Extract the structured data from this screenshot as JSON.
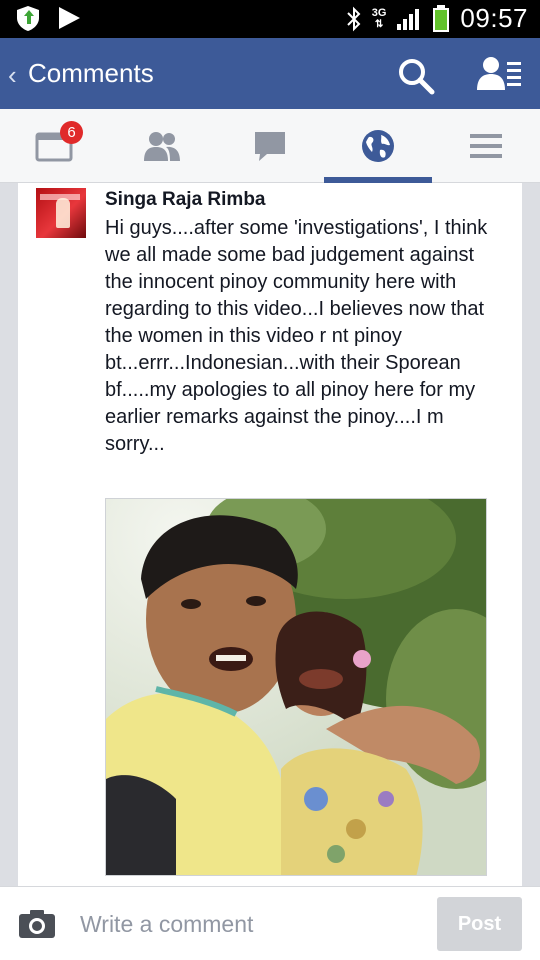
{
  "status_bar": {
    "network_label": "3G",
    "time": "09:57",
    "icons": [
      "shield-icon",
      "play-icon",
      "bluetooth-icon",
      "signal-icon",
      "battery-icon"
    ]
  },
  "app_bar": {
    "back_glyph": "‹",
    "title": "Comments",
    "icons": [
      "search-icon",
      "friends-icon"
    ],
    "background": "#3d5a98"
  },
  "tabs": [
    {
      "id": "news-feed",
      "icon": "news-feed-icon",
      "badge": "6"
    },
    {
      "id": "friend-requests",
      "icon": "friends-icon"
    },
    {
      "id": "messages",
      "icon": "chat-icon"
    },
    {
      "id": "notifications",
      "icon": "globe-icon",
      "active": true
    },
    {
      "id": "more",
      "icon": "menu-icon"
    }
  ],
  "comment": {
    "author": "Singa Raja Rimba",
    "text": "Hi guys....after some 'investigations', I think we all made some bad judgement against the innocent pinoy community here with regarding to this video...I believes now that the women in this video r nt pinoy bt...errr...Indonesian...with their Sporean bf.....my apologies to all pinoy here for my earlier remarks against the pinoy....I m sorry...",
    "attachment": "photo"
  },
  "composer": {
    "placeholder": "Write a comment",
    "post_label": "Post",
    "icon": "camera-icon"
  },
  "colors": {
    "accent": "#3d5a98",
    "badge": "#e02a2a",
    "background": "#dcdee3"
  }
}
